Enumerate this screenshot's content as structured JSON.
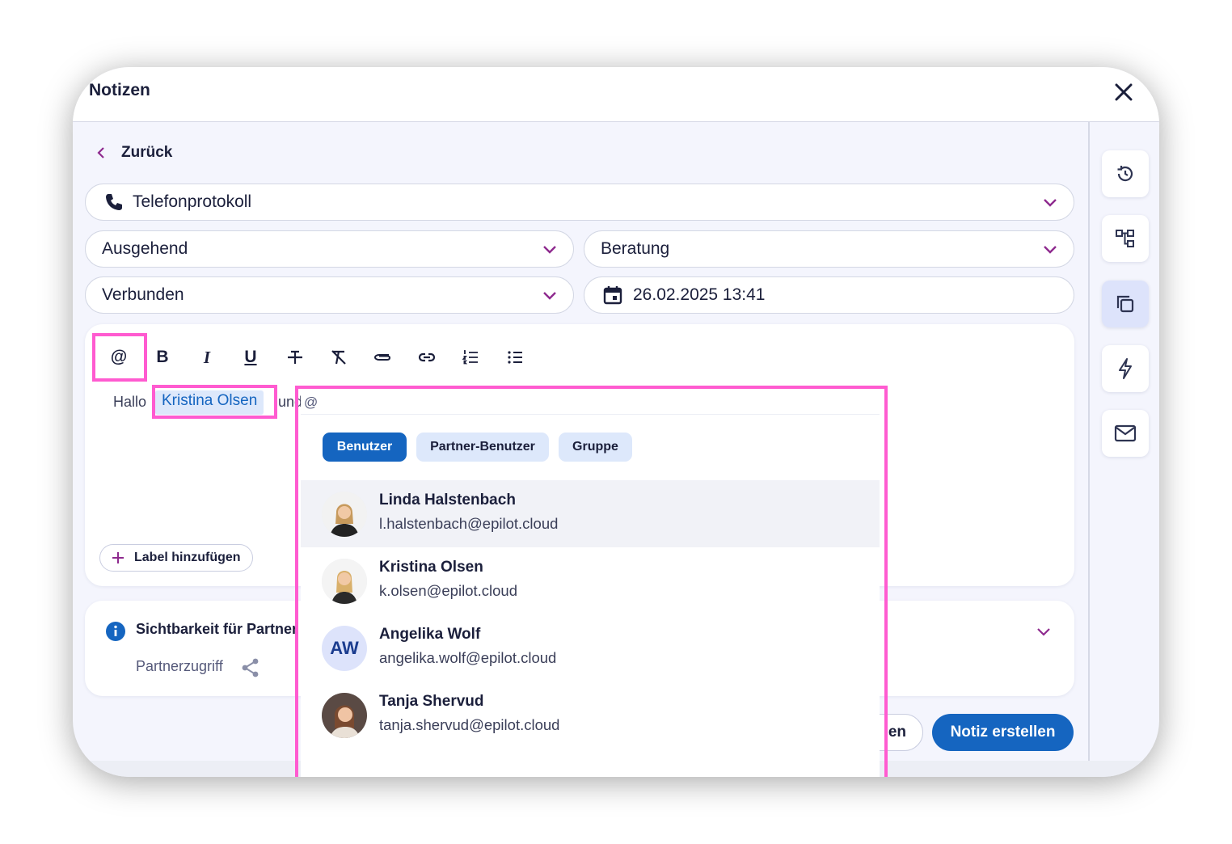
{
  "window": {
    "title": "Notizen"
  },
  "nav": {
    "back_label": "Zurück"
  },
  "form": {
    "type": "Telefonprotokoll",
    "direction": "Ausgehend",
    "category": "Beratung",
    "status": "Verbunden",
    "datetime": "26.02.2025 13:41"
  },
  "toolbar": {
    "mention": "@",
    "bold": "B",
    "italic": "I",
    "underline": "U"
  },
  "editor": {
    "text_before": "Hallo",
    "mention_name": "Kristina Olsen",
    "text_after": "und",
    "add_label": "Label hinzufügen"
  },
  "visibility": {
    "title": "Sichtbarkeit für Partner",
    "subtitle": "Partnerzugriff"
  },
  "footer": {
    "cancel_partial": "en",
    "submit": "Notiz erstellen"
  },
  "mention_dropdown": {
    "query": "@",
    "tabs": [
      "Benutzer",
      "Partner-Benutzer",
      "Gruppe"
    ],
    "users": [
      {
        "name": "Linda Halstenbach",
        "email": "l.halstenbach@epilot.cloud"
      },
      {
        "name": "Kristina Olsen",
        "email": "k.olsen@epilot.cloud"
      },
      {
        "name": "Angelika Wolf",
        "email": "angelika.wolf@epilot.cloud",
        "initials": "AW"
      },
      {
        "name": "Tanja Shervud",
        "email": "tanja.shervud@epilot.cloud"
      }
    ]
  },
  "colors": {
    "primary": "#1565c0",
    "highlight": "#ff5bd0",
    "chevron": "#8e2a8e"
  }
}
